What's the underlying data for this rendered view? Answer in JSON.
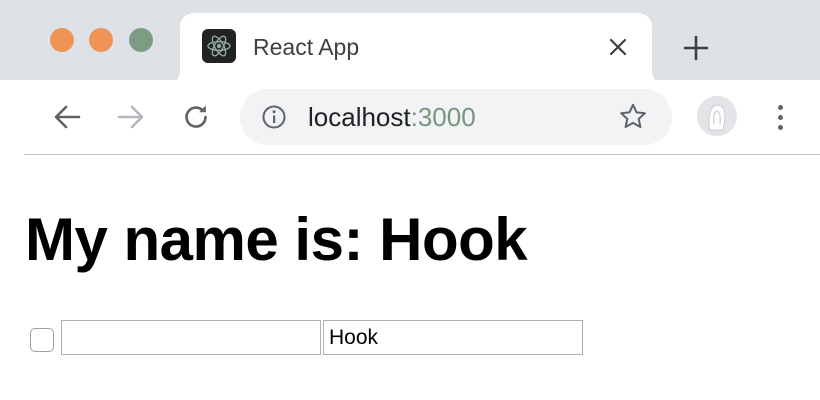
{
  "tab": {
    "title": "React App",
    "favicon": "react-logo-icon"
  },
  "address_bar": {
    "host": "localhost",
    "port": ":3000"
  },
  "page": {
    "heading": "My name is: Hook",
    "checkbox_checked": false,
    "first_name_value": "",
    "last_name_value": "Hook"
  },
  "colors": {
    "tabstrip": "#dee1e6",
    "traffic_close": "#ef9457",
    "traffic_minimize": "#ef9457",
    "traffic_zoom": "#7e9c83",
    "url_port": "#78967e"
  }
}
